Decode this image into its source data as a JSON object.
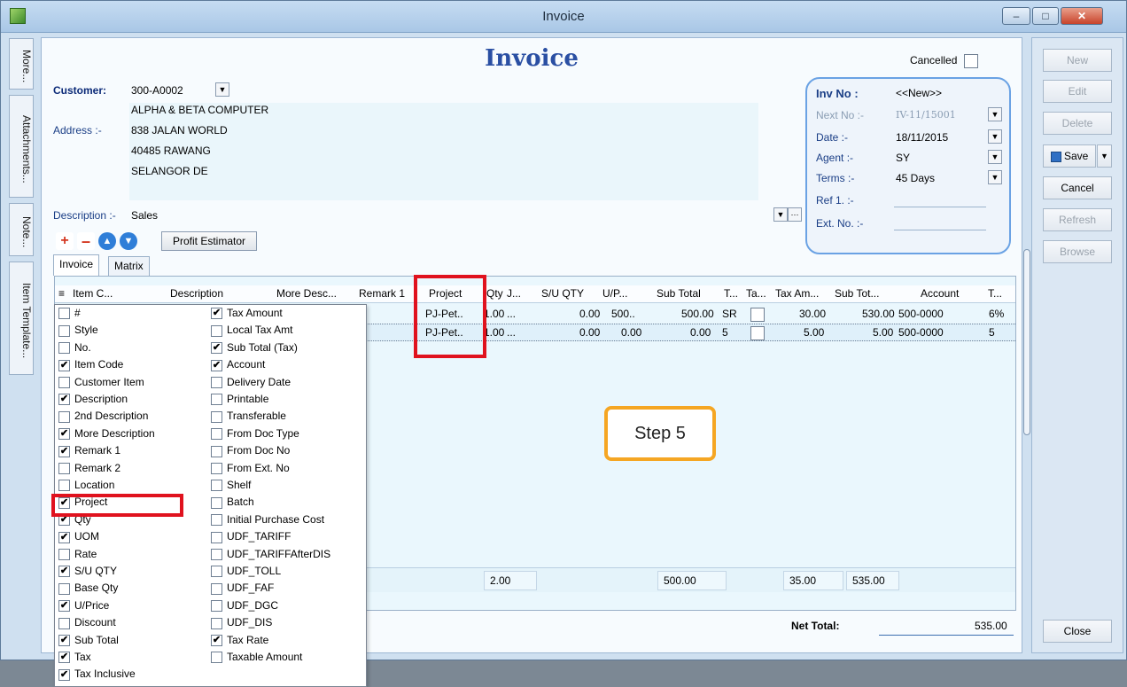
{
  "window": {
    "title": "Invoice"
  },
  "side_tabs": [
    "More...",
    "Attachments...",
    "Note...",
    "Item Template..."
  ],
  "form": {
    "heading": "Invoice",
    "cancelled_label": "Cancelled",
    "customer_label": "Customer:",
    "customer_code": "300-A0002",
    "company_name": "ALPHA & BETA COMPUTER",
    "address_label": "Address :-",
    "address_lines": [
      "838 JALAN WORLD",
      "40485 RAWANG",
      "SELANGOR DE"
    ],
    "description_label": "Description :-",
    "description_value": "Sales",
    "profit_estimator": "Profit Estimator"
  },
  "info": {
    "inv_no_label": "Inv No :",
    "inv_no_value": "<<New>>",
    "next_no_label": "Next No :-",
    "next_no_value": "IV-11/15001",
    "date_label": "Date :-",
    "date_value": "18/11/2015",
    "agent_label": "Agent :-",
    "agent_value": "SY",
    "terms_label": "Terms :-",
    "terms_value": "45 Days",
    "ref1_label": "Ref 1. :-",
    "ext_no_label": "Ext. No. :-"
  },
  "tabs": [
    "Invoice",
    "Matrix"
  ],
  "grid": {
    "columns": [
      "Item C...",
      "Description",
      "More Desc...",
      "Remark 1",
      "Project",
      "Qty",
      "J...",
      "S/U QTY",
      "U/P...",
      "Sub Total",
      "T...",
      "Ta...",
      "Tax Am...",
      "Sub Tot...",
      "Account",
      "T..."
    ],
    "rows": [
      {
        "project": "PJ-Pet..",
        "qty": "1.00",
        "j": "...",
        "su_qty": "0.00",
        "up": "500..",
        "sub_total": "500.00",
        "tax_code": "SR",
        "tax_amt": "30.00",
        "sub_total_tax": "530.00",
        "account": "500-0000",
        "tax_rate": "6%"
      },
      {
        "project": "PJ-Pet..",
        "qty": "1.00",
        "j": "...",
        "su_qty": "0.00",
        "up": "0.00",
        "sub_total": "0.00",
        "tax_code": "5",
        "tax_amt": "5.00",
        "sub_total_tax": "5.00",
        "account": "500-0000",
        "tax_rate": "5"
      }
    ],
    "footer": {
      "qty": "2.00",
      "sub_total": "500.00",
      "tax": "35.00",
      "total": "535.00"
    }
  },
  "popup": {
    "left_items": [
      {
        "label": "#",
        "checked": false
      },
      {
        "label": "Style",
        "checked": false
      },
      {
        "label": "No.",
        "checked": false
      },
      {
        "label": "Item Code",
        "checked": true
      },
      {
        "label": "Customer Item",
        "checked": false
      },
      {
        "label": "Description",
        "checked": true
      },
      {
        "label": "2nd Description",
        "checked": false
      },
      {
        "label": "More Description",
        "checked": true
      },
      {
        "label": "Remark 1",
        "checked": true
      },
      {
        "label": "Remark 2",
        "checked": false
      },
      {
        "label": "Location",
        "checked": false
      },
      {
        "label": "Project",
        "checked": true
      },
      {
        "label": "Qty",
        "checked": true
      },
      {
        "label": "UOM",
        "checked": true
      },
      {
        "label": "Rate",
        "checked": false
      },
      {
        "label": "S/U QTY",
        "checked": true
      },
      {
        "label": "Base Qty",
        "checked": false
      },
      {
        "label": "U/Price",
        "checked": true
      },
      {
        "label": "Discount",
        "checked": false
      },
      {
        "label": "Sub Total",
        "checked": true
      },
      {
        "label": "Tax",
        "checked": true
      },
      {
        "label": "Tax Inclusive",
        "checked": true
      }
    ],
    "right_items": [
      {
        "label": "Tax Amount",
        "checked": true
      },
      {
        "label": "Local Tax Amt",
        "checked": false
      },
      {
        "label": "Sub Total (Tax)",
        "checked": true
      },
      {
        "label": "Account",
        "checked": true
      },
      {
        "label": "Delivery Date",
        "checked": false
      },
      {
        "label": "Printable",
        "checked": false
      },
      {
        "label": "Transferable",
        "checked": false
      },
      {
        "label": "From Doc Type",
        "checked": false
      },
      {
        "label": "From Doc No",
        "checked": false
      },
      {
        "label": "From Ext. No",
        "checked": false
      },
      {
        "label": "Shelf",
        "checked": false
      },
      {
        "label": "Batch",
        "checked": false
      },
      {
        "label": "Initial Purchase Cost",
        "checked": false
      },
      {
        "label": "UDF_TARIFF",
        "checked": false
      },
      {
        "label": "UDF_TARIFFAfterDIS",
        "checked": false
      },
      {
        "label": "UDF_TOLL",
        "checked": false
      },
      {
        "label": "UDF_FAF",
        "checked": false
      },
      {
        "label": "UDF_DGC",
        "checked": false
      },
      {
        "label": "UDF_DIS",
        "checked": false
      },
      {
        "label": "Tax Rate",
        "checked": true
      },
      {
        "label": "Taxable Amount",
        "checked": false
      }
    ]
  },
  "annotation": {
    "step": "Step 5"
  },
  "totals": {
    "net_total_label": "Net Total:",
    "net_total_value": "535.00"
  },
  "right_buttons": {
    "new": "New",
    "edit": "Edit",
    "delete": "Delete",
    "save": "Save",
    "cancel": "Cancel",
    "refresh": "Refresh",
    "browse": "Browse",
    "close": "Close"
  },
  "colors": {
    "highlight": "#e0121e",
    "step_border": "#f5a623",
    "heading": "#2a4fa3"
  }
}
